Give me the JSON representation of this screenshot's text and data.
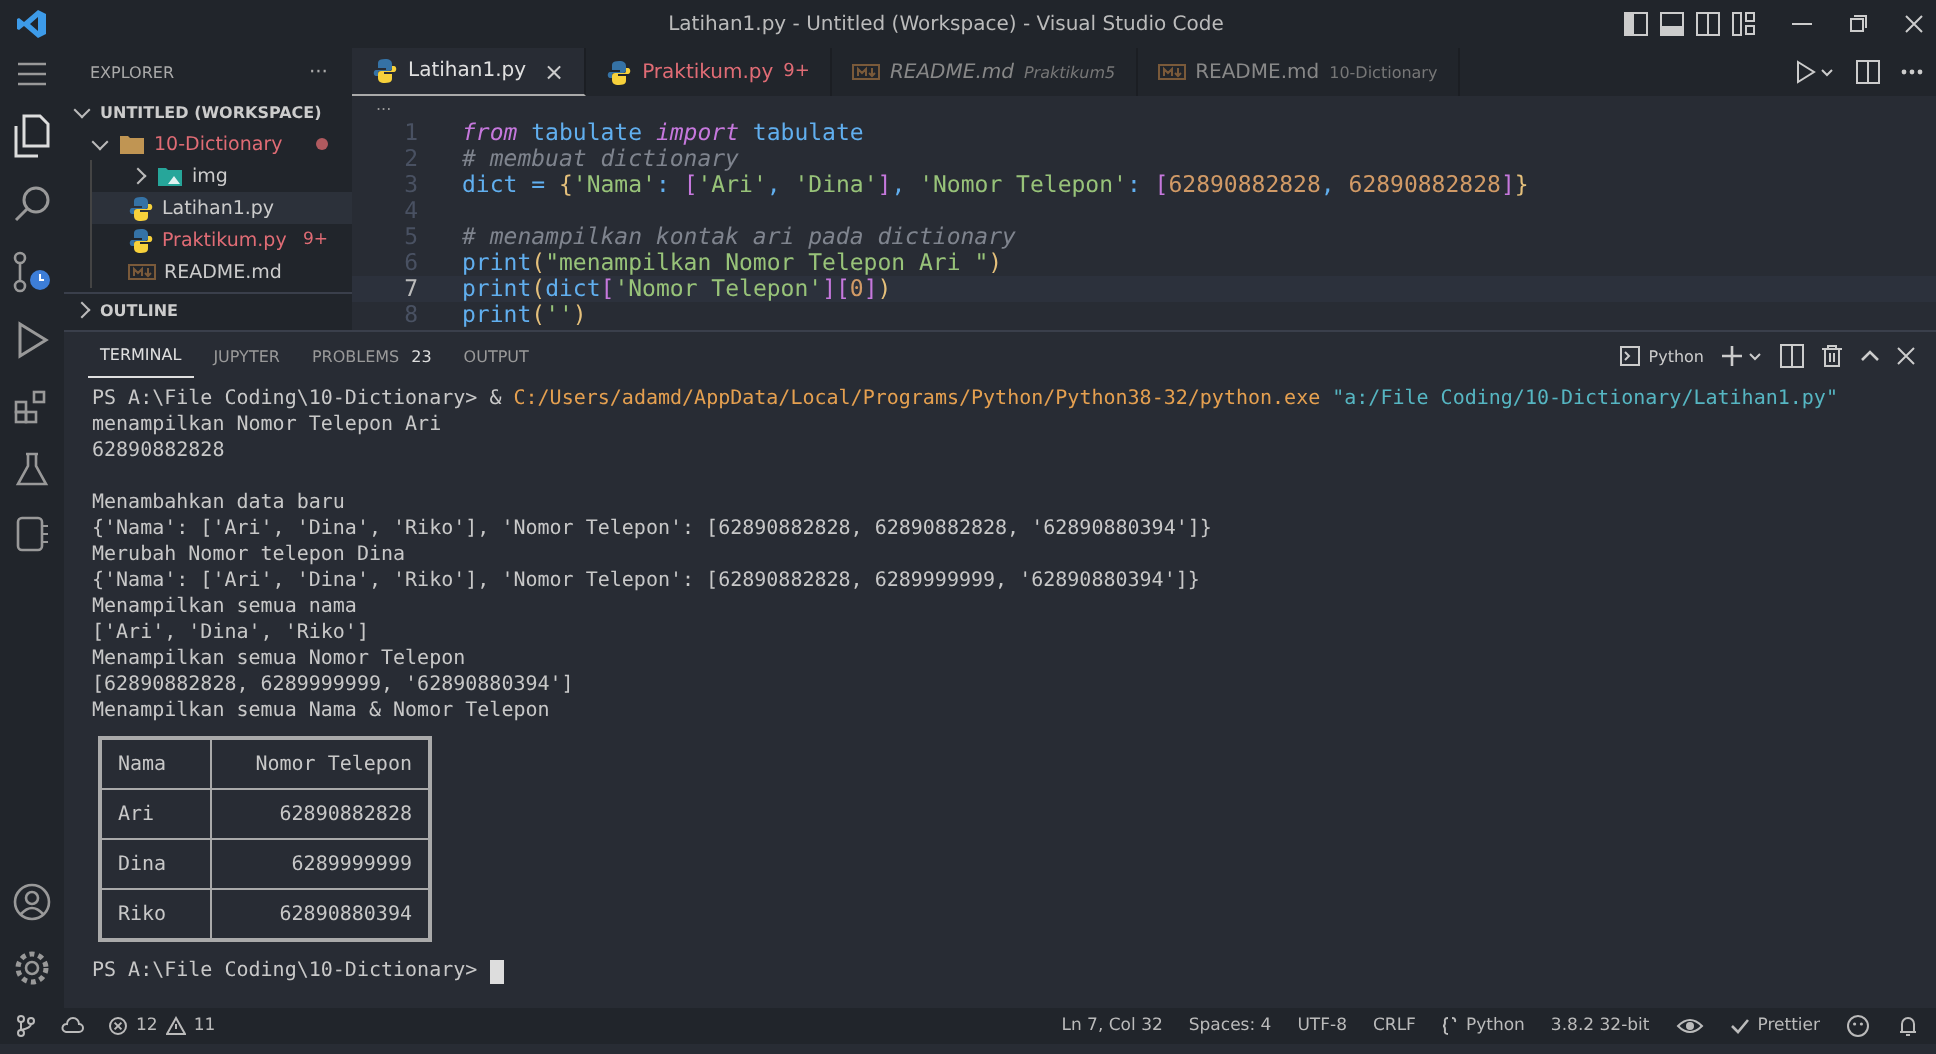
{
  "window": {
    "title": "Latihan1.py - Untitled (Workspace) - Visual Studio Code"
  },
  "sidebar": {
    "title": "EXPLORER",
    "more": "···",
    "workspace": {
      "label": "UNTITLED (WORKSPACE)",
      "expanded": true
    },
    "tree": [
      {
        "label": "10-Dictionary",
        "kind": "folder",
        "expanded": true,
        "modified": true,
        "selected": false,
        "children": [
          {
            "label": "img",
            "kind": "folder",
            "expanded": false,
            "modified": false,
            "selected": false
          },
          {
            "label": "Latihan1.py",
            "kind": "python",
            "modified": false,
            "selected": true
          },
          {
            "label": "Praktikum.py",
            "kind": "python",
            "modified": true,
            "selected": false,
            "badge": "9+"
          },
          {
            "label": "README.md",
            "kind": "markdown",
            "modified": false,
            "selected": false
          }
        ]
      }
    ],
    "outline": {
      "label": "OUTLINE",
      "expanded": false
    }
  },
  "tabs": [
    {
      "label": "Latihan1.py",
      "kind": "python",
      "selected": true,
      "modified": false,
      "close": "×"
    },
    {
      "label": "Praktikum.py",
      "kind": "python",
      "selected": false,
      "modified": true,
      "badge": "9+"
    },
    {
      "label": "README.md",
      "kind": "markdown",
      "selected": false,
      "modified": false,
      "preview": true,
      "detail": "Praktikum5"
    },
    {
      "label": "README.md",
      "kind": "markdown",
      "selected": false,
      "modified": false,
      "preview": false,
      "detail": "10-Dictionary"
    }
  ],
  "breadcrumb": "...",
  "editor": {
    "lines": [
      {
        "number": "1",
        "current": false,
        "tokens": [
          {
            "text": "from",
            "kind": "keyword"
          },
          {
            "text": " tabulate ",
            "kind": "plain"
          },
          {
            "text": "import",
            "kind": "keyword"
          },
          {
            "text": " tabulate",
            "kind": "plain"
          }
        ]
      },
      {
        "number": "2",
        "current": false,
        "tokens": [
          {
            "text": "# membuat dictionary",
            "kind": "comment"
          }
        ]
      },
      {
        "number": "3",
        "current": false,
        "tokens": [
          {
            "text": "dict = ",
            "kind": "plain"
          },
          {
            "text": "{",
            "kind": "brace"
          },
          {
            "text": "'Nama'",
            "kind": "string"
          },
          {
            "text": ": ",
            "kind": "plain"
          },
          {
            "text": "[",
            "kind": "bracket"
          },
          {
            "text": "'Ari'",
            "kind": "string"
          },
          {
            "text": ", ",
            "kind": "plain"
          },
          {
            "text": "'Dina'",
            "kind": "string"
          },
          {
            "text": "]",
            "kind": "bracket"
          },
          {
            "text": ", ",
            "kind": "plain"
          },
          {
            "text": "'Nomor Telepon'",
            "kind": "string"
          },
          {
            "text": ": ",
            "kind": "plain"
          },
          {
            "text": "[",
            "kind": "bracket"
          },
          {
            "text": "62890882828",
            "kind": "number"
          },
          {
            "text": ", ",
            "kind": "plain"
          },
          {
            "text": "62890882828",
            "kind": "number"
          },
          {
            "text": "]",
            "kind": "bracket"
          },
          {
            "text": "}",
            "kind": "brace"
          }
        ]
      },
      {
        "number": "4",
        "current": false
      },
      {
        "number": "5",
        "current": false,
        "tokens": [
          {
            "text": "# menampilkan kontak ari pada dictionary",
            "kind": "comment"
          }
        ]
      },
      {
        "number": "6",
        "current": false,
        "tokens": [
          {
            "text": "print",
            "kind": "plain"
          },
          {
            "text": "(",
            "kind": "brace"
          },
          {
            "text": "\"menampilkan Nomor Telepon Ari \"",
            "kind": "string"
          },
          {
            "text": ")",
            "kind": "brace"
          }
        ]
      },
      {
        "number": "7",
        "current": true,
        "tokens": [
          {
            "text": "print",
            "kind": "plain"
          },
          {
            "text": "(",
            "kind": "brace"
          },
          {
            "text": "dict",
            "kind": "plain"
          },
          {
            "text": "[",
            "kind": "bracket"
          },
          {
            "text": "'Nomor Telepon'",
            "kind": "string"
          },
          {
            "text": "][",
            "kind": "bracket"
          },
          {
            "text": "0",
            "kind": "number"
          },
          {
            "text": "]",
            "kind": "bracket"
          },
          {
            "text": ")",
            "kind": "brace"
          }
        ]
      },
      {
        "number": "8",
        "current": false,
        "tokens": [
          {
            "text": "print",
            "kind": "plain"
          },
          {
            "text": "(",
            "kind": "brace"
          },
          {
            "text": "''",
            "kind": "string"
          },
          {
            "text": ")",
            "kind": "brace"
          }
        ]
      }
    ]
  },
  "panel": {
    "tabs": [
      {
        "label": "TERMINAL",
        "selected": true
      },
      {
        "label": "JUPYTER",
        "selected": false
      },
      {
        "label": "PROBLEMS",
        "selected": false,
        "badge": "23"
      },
      {
        "label": "OUTPUT",
        "selected": false
      }
    ],
    "terminal_name": "Python",
    "terminal": [
      {
        "kind": "command",
        "prompt": "PS A:\\File Coding\\10-Dictionary> ",
        "op": "& ",
        "exe": "C:/Users/adamd/AppData/Local/Programs/Python/Python38-32/python.exe",
        "arg": "\"a:/File Coding/10-Dictionary/Latihan1.py\""
      },
      {
        "kind": "text",
        "text": "menampilkan Nomor Telepon Ari"
      },
      {
        "kind": "text",
        "text": "62890882828"
      },
      {
        "kind": "blank"
      },
      {
        "kind": "text",
        "text": "Menambahkan data baru"
      },
      {
        "kind": "text",
        "text": "{'Nama': ['Ari', 'Dina', 'Riko'], 'Nomor Telepon': [62890882828, 62890882828, '62890880394']}"
      },
      {
        "kind": "text",
        "text": "Merubah Nomor telepon Dina"
      },
      {
        "kind": "text",
        "text": "{'Nama': ['Ari', 'Dina', 'Riko'], 'Nomor Telepon': [62890882828, 6289999999, '62890880394']}"
      },
      {
        "kind": "text",
        "text": "Menampilkan semua nama"
      },
      {
        "kind": "text",
        "text": "['Ari', 'Dina', 'Riko']"
      },
      {
        "kind": "text",
        "text": "Menampilkan semua Nomor Telepon"
      },
      {
        "kind": "text",
        "text": "[62890882828, 6289999999, '62890880394']"
      },
      {
        "kind": "text",
        "text": "Menampilkan semua Nama & Nomor Telepon"
      },
      {
        "kind": "table",
        "columns": [
          "Nama",
          "Nomor Telepon"
        ],
        "rows": [
          [
            "Ari",
            "62890882828"
          ],
          [
            "Dina",
            "6289999999"
          ],
          [
            "Riko",
            "62890880394"
          ]
        ]
      },
      {
        "kind": "prompt",
        "prompt": "PS A:\\File Coding\\10-Dictionary> "
      }
    ]
  },
  "status_bar": {
    "errors": "12",
    "warnings": "11",
    "position": "Ln 7, Col 32",
    "spaces": "Spaces: 4",
    "encoding": "UTF-8",
    "eol": "CRLF",
    "language": "Python",
    "interpreter": "3.8.2 32-bit",
    "formatter": "Prettier"
  }
}
